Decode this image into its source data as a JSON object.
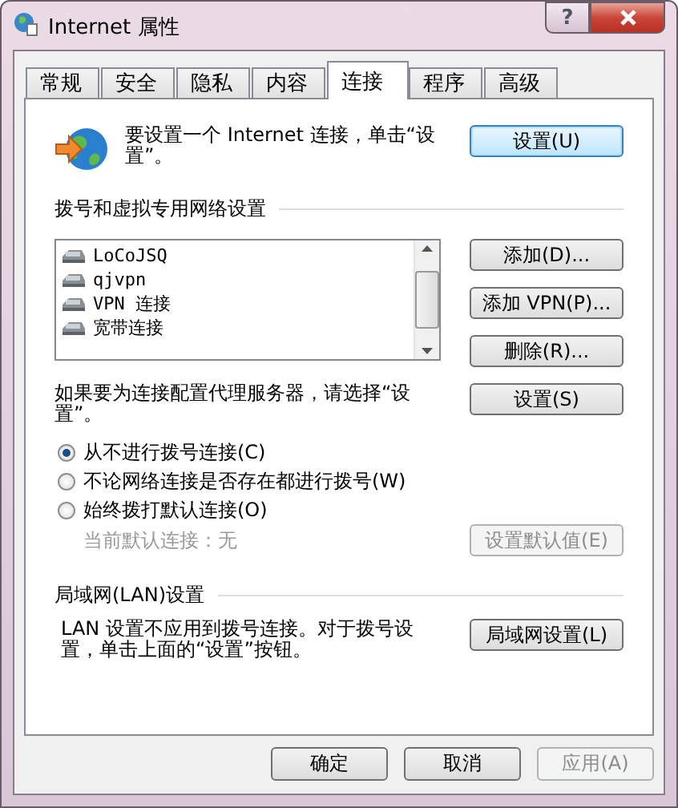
{
  "window": {
    "title": "Internet 属性",
    "help": "?"
  },
  "tabs": [
    {
      "label": "常规",
      "selected": false
    },
    {
      "label": "安全",
      "selected": false
    },
    {
      "label": "隐私",
      "selected": false
    },
    {
      "label": "内容",
      "selected": false
    },
    {
      "label": "连接",
      "selected": true
    },
    {
      "label": "程序",
      "selected": false
    },
    {
      "label": "高级",
      "selected": false
    }
  ],
  "setup": {
    "text": "要设置一个 Internet 连接，单击“设置”。",
    "button": "设置(U)"
  },
  "dialup": {
    "heading": "拨号和虚拟专用网络设置",
    "connections": [
      {
        "name": "LoCoJSQ",
        "selected": false
      },
      {
        "name": "qjvpn",
        "selected": false
      },
      {
        "name": "VPN 连接",
        "selected": false
      },
      {
        "name": "宽带连接",
        "selected": false
      }
    ],
    "buttons": [
      {
        "label": "添加(D)...",
        "disabled": false
      },
      {
        "label": "添加 VPN(P)...",
        "disabled": false
      },
      {
        "label": "删除(R)...",
        "disabled": false
      }
    ],
    "proxy_text": "如果要为连接配置代理服务器，请选择“设置”。",
    "proxy_button": "设置(S)",
    "options": [
      {
        "label": "从不进行拨号连接(C)",
        "selected": true
      },
      {
        "label": "不论网络连接是否存在都进行拨号(W)",
        "selected": false
      },
      {
        "label": "始终拨打默认连接(O)",
        "selected": false
      }
    ],
    "default_label": "当前默认连接：",
    "default_value": "无",
    "default_button": {
      "label": "设置默认值(E)",
      "disabled": true
    }
  },
  "lan": {
    "heading": "局域网(LAN)设置",
    "text": "LAN 设置不应用到拨号连接。对于拨号设置，单击上面的“设置”按钮。",
    "button": "局域网设置(L)"
  },
  "footer": [
    {
      "label": "确定",
      "disabled": false
    },
    {
      "label": "取消",
      "disabled": false
    },
    {
      "label": "应用(A)",
      "disabled": true
    }
  ]
}
